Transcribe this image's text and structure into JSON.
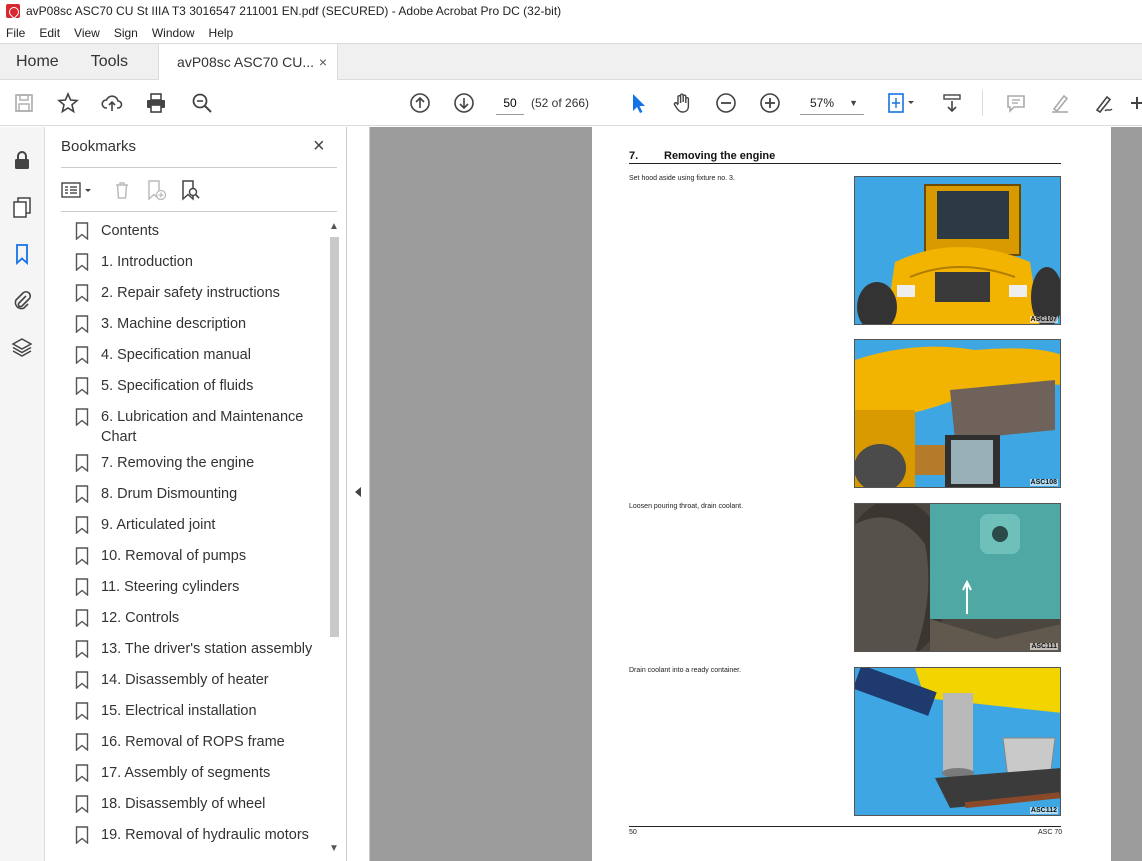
{
  "window": {
    "title": "avP08sc ASC70 CU St IIIA T3 3016547 211001 EN.pdf (SECURED) - Adobe Acrobat Pro DC (32-bit)"
  },
  "menu": [
    "File",
    "Edit",
    "View",
    "Sign",
    "Window",
    "Help"
  ],
  "tabs": {
    "home": "Home",
    "tools": "Tools",
    "document": "avP08sc ASC70 CU...",
    "close": "×"
  },
  "toolbar": {
    "page_value": "50",
    "page_count": "(52 of 266)",
    "zoom": "57%"
  },
  "bookmarks": {
    "title": "Bookmarks",
    "close": "×",
    "items": [
      "Contents",
      "1. Introduction",
      "2. Repair safety instructions",
      "3. Machine description",
      "4. Specification manual",
      "5. Specification of fluids",
      "6. Lubrication and Maintenance Chart",
      "7. Removing the engine",
      "8. Drum Dismounting",
      "9. Articulated joint",
      "10. Removal of pumps",
      "11. Steering cylinders",
      "12. Controls",
      "13. The driver's station assembly",
      "14. Disassembly of heater",
      "15. Electrical installation",
      "16. Removal of ROPS frame",
      "17. Assembly of segments",
      "18. Disassembly of wheel",
      "19. Removal of hydraulic motors"
    ]
  },
  "page": {
    "section_number": "7.",
    "section_title": "Removing the engine",
    "texts": [
      "Set hood aside using fixture no. 3.",
      "Loosen pouring throat, drain coolant.",
      "Drain coolant into a ready container."
    ],
    "photos": [
      "ASC107",
      "ASC108",
      "ASC111",
      "ASC112"
    ],
    "footer_left": "50",
    "footer_right": "ASC 70"
  },
  "colors": {
    "accent_blue": "#1473e6",
    "acrobat_red": "#d7282f",
    "machine_yellow": "#f2b400",
    "photo_sky": "#3fa9e0"
  }
}
